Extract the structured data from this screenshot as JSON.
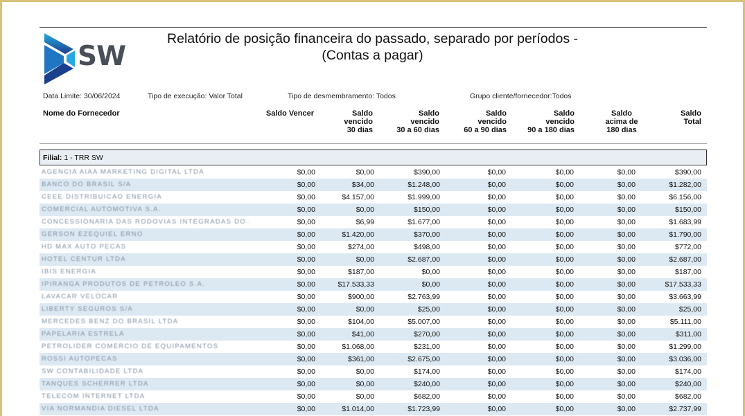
{
  "header": {
    "title_line1": "Relatório de posição financeira do passado, separado por períodos -",
    "title_line2": "(Contas a pagar)",
    "logo_text": "SW",
    "data_limite": "Data Limite: 30/06/2024",
    "tipo_execucao": "Tipo de execução: Valor Total",
    "tipo_desmembramento": "Tipo de desmembramento: Todos",
    "grupo": "Grupo cliente/fornecedor:Todos"
  },
  "columns": {
    "nome": "Nome do Fornecedor",
    "saldo_vencer": "Saldo Vencer",
    "c30": [
      "Saldo",
      "vencido",
      "30 dias"
    ],
    "c60": [
      "Saldo",
      "vencido",
      "30 a 60 dias"
    ],
    "c90": [
      "Saldo",
      "vencido",
      "60 a 90 dias"
    ],
    "c180": [
      "Saldo",
      "vencido",
      "90 a 180 dias"
    ],
    "cacima": [
      "Saldo",
      "acima de",
      "180 dias"
    ],
    "total": [
      "Saldo",
      "Total"
    ]
  },
  "filial": {
    "label": "Filial:",
    "value": "1 - TRR SW"
  },
  "rows": [
    {
      "name": "AGENCIA AIAA MARKETING DIGITAL LTDA",
      "v": [
        "$0,00",
        "$0,00",
        "$390,00",
        "$0,00",
        "$0,00",
        "$0,00",
        "$390,00"
      ]
    },
    {
      "name": "BANCO DO BRASIL S/A",
      "v": [
        "$0,00",
        "$34,00",
        "$1.248,00",
        "$0,00",
        "$0,00",
        "$0,00",
        "$1.282,00"
      ]
    },
    {
      "name": "CEEE DISTRIBUICAO ENERGIA",
      "v": [
        "$0,00",
        "$4.157,00",
        "$1.999,00",
        "$0,00",
        "$0,00",
        "$0,00",
        "$6.156,00"
      ]
    },
    {
      "name": "COMERCIAL AUTOMOTIVA S.A.",
      "v": [
        "$0,00",
        "$0,00",
        "$150,00",
        "$0,00",
        "$0,00",
        "$0,00",
        "$150,00"
      ]
    },
    {
      "name": "CONCESSIONARIA DAS RODOVIAS INTEGRADAS DO SUL S.A.",
      "v": [
        "$0,00",
        "$6,99",
        "$1.677,00",
        "$0,00",
        "$0,00",
        "$0,00",
        "$1.683,99"
      ]
    },
    {
      "name": "GERSON EZEQUIEL  ERNO",
      "v": [
        "$0,00",
        "$1.420,00",
        "$370,00",
        "$0,00",
        "$0,00",
        "$0,00",
        "$1.790,00"
      ]
    },
    {
      "name": "HD MAX AUTO PECAS",
      "v": [
        "$0,00",
        "$274,00",
        "$498,00",
        "$0,00",
        "$0,00",
        "$0,00",
        "$772,00"
      ]
    },
    {
      "name": "HOTEL CENTUR LTDA",
      "v": [
        "$0,00",
        "$0,00",
        "$2.687,00",
        "$0,00",
        "$0,00",
        "$0,00",
        "$2.687,00"
      ]
    },
    {
      "name": "IBIS ENERGIA",
      "v": [
        "$0,00",
        "$187,00",
        "$0,00",
        "$0,00",
        "$0,00",
        "$0,00",
        "$187,00"
      ]
    },
    {
      "name": "IPIRANGA PRODUTOS DE PETROLEO S.A.",
      "v": [
        "$0,00",
        "$17.533,33",
        "$0,00",
        "$0,00",
        "$0,00",
        "$0,00",
        "$17.533,33"
      ]
    },
    {
      "name": "LAVACAR VELOCAR",
      "v": [
        "$0,00",
        "$900,00",
        "$2.763,99",
        "$0,00",
        "$0,00",
        "$0,00",
        "$3.663,99"
      ]
    },
    {
      "name": "LIBERTY SEGUROS S/A",
      "v": [
        "$0,00",
        "$0,00",
        "$25,00",
        "$0,00",
        "$0,00",
        "$0,00",
        "$25,00"
      ]
    },
    {
      "name": "MERCEDES BENZ DO BRASIL LTDA",
      "v": [
        "$0,00",
        "$104,00",
        "$5.007,00",
        "$0,00",
        "$0,00",
        "$0,00",
        "$5.111,00"
      ]
    },
    {
      "name": "PAPELARIA ESTRELA",
      "v": [
        "$0,00",
        "$41,00",
        "$270,00",
        "$0,00",
        "$0,00",
        "$0,00",
        "$311,00"
      ]
    },
    {
      "name": "PETROLIDER COMERCIO DE EQUIPAMENTOS",
      "v": [
        "$0,00",
        "$1.068,00",
        "$231,00",
        "$0,00",
        "$0,00",
        "$0,00",
        "$1.299,00"
      ]
    },
    {
      "name": "ROSSI AUTOPECAS",
      "v": [
        "$0,00",
        "$361,00",
        "$2.675,00",
        "$0,00",
        "$0,00",
        "$0,00",
        "$3.036,00"
      ]
    },
    {
      "name": "SW CONTABILIDADE LTDA",
      "v": [
        "$0,00",
        "$0,00",
        "$174,00",
        "$0,00",
        "$0,00",
        "$0,00",
        "$174,00"
      ]
    },
    {
      "name": "TANQUES SCHERRER LTDA",
      "v": [
        "$0,00",
        "$0,00",
        "$240,00",
        "$0,00",
        "$0,00",
        "$0,00",
        "$240,00"
      ]
    },
    {
      "name": "TELECOM INTERNET LTDA",
      "v": [
        "$0,00",
        "$0,00",
        "$682,00",
        "$0,00",
        "$0,00",
        "$0,00",
        "$682,00"
      ]
    },
    {
      "name": "VIA NORMANDIA DIESEL LTDA",
      "v": [
        "$0,00",
        "$1.014,00",
        "$1.723,99",
        "$0,00",
        "$0,00",
        "$0,00",
        "$2.737,99"
      ]
    }
  ]
}
